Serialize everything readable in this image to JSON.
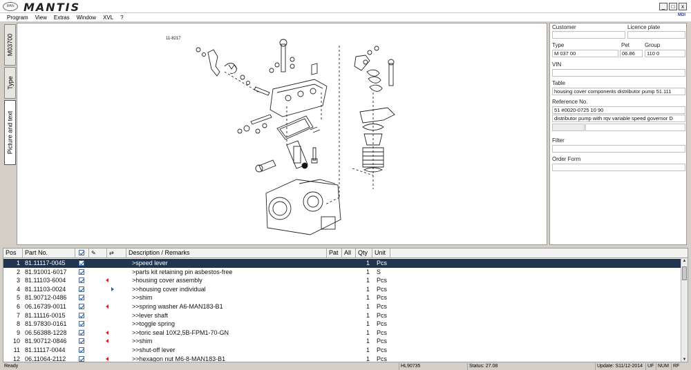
{
  "app": {
    "title": "MANTIS",
    "logo_text": "MAN"
  },
  "window_buttons": {
    "minimize": "_",
    "restore": "□",
    "close": "x"
  },
  "menu": [
    "Program",
    "View",
    "Extras",
    "Window",
    "XVL",
    "?"
  ],
  "mdi_icon_text": "MDI",
  "side_tabs": [
    "M03700",
    "Type",
    "Picture and text"
  ],
  "drawing": {
    "label": "11-8217"
  },
  "info": {
    "customer_label": "Customer",
    "customer_value": "",
    "licence_label": "Licence plate",
    "licence_value": "",
    "type_label": "Type",
    "type_value": "M 037 00",
    "pet_label": "Pet",
    "pet_value": "06.86",
    "group_label": "Group",
    "group_value": "110 0",
    "vin_label": "VIN",
    "vin_value": "",
    "table_label": "Table",
    "table_value": "housing cover components distributor pump  51.111",
    "ref_label": "Reference No.",
    "ref_value": "51 #0020-0725 10 90",
    "ref_desc": "distributor pump with rqv variable speed governor D",
    "filter_label": "Filter",
    "filter_value": "",
    "order_label": "Order Form",
    "order_value": ""
  },
  "table": {
    "headers": {
      "pos": "Pos",
      "part": "Part No.",
      "desc": "Description / Remarks",
      "pat": "Pat",
      "all": "All",
      "qty": "Qty",
      "unit": "Unit"
    },
    "rows": [
      {
        "pos": "1",
        "part": "81.11117-0045",
        "checked": true,
        "mark": "",
        "desc": ">speed lever",
        "qty": "1",
        "unit": "Pcs",
        "selected": true
      },
      {
        "pos": "2",
        "part": "81.91001-6017",
        "checked": true,
        "mark": "",
        "desc": ">parts kit retaining pin asbestos-free",
        "qty": "1",
        "unit": "S",
        "selected": false
      },
      {
        "pos": "3",
        "part": "81.11103-6004",
        "checked": true,
        "mark": "red",
        "desc": ">housing cover assembly",
        "qty": "1",
        "unit": "Pcs",
        "selected": false
      },
      {
        "pos": "4",
        "part": "81.11103-0024",
        "checked": true,
        "mark": "blue",
        "desc": ">>housing cover individual",
        "qty": "1",
        "unit": "Pcs",
        "selected": false
      },
      {
        "pos": "5",
        "part": "81.90712-0486",
        "checked": true,
        "mark": "",
        "desc": ">>shim",
        "qty": "1",
        "unit": "Pcs",
        "selected": false
      },
      {
        "pos": "6",
        "part": "06.16739-0011",
        "checked": true,
        "mark": "red",
        "desc": ">>spring washer A6-MAN183-B1",
        "qty": "1",
        "unit": "Pcs",
        "selected": false
      },
      {
        "pos": "7",
        "part": "81.11116-0015",
        "checked": true,
        "mark": "",
        "desc": ">>lever shaft",
        "qty": "1",
        "unit": "Pcs",
        "selected": false
      },
      {
        "pos": "8",
        "part": "81.97830-0161",
        "checked": true,
        "mark": "",
        "desc": ">>toggle spring",
        "qty": "1",
        "unit": "Pcs",
        "selected": false
      },
      {
        "pos": "9",
        "part": "06.56388-1228",
        "checked": true,
        "mark": "red",
        "desc": ">>toric seal 10X2,5B-FPM1-70-GN",
        "qty": "1",
        "unit": "Pcs",
        "selected": false
      },
      {
        "pos": "10",
        "part": "81.90712-0846",
        "checked": true,
        "mark": "red",
        "desc": ">>shim",
        "qty": "1",
        "unit": "Pcs",
        "selected": false
      },
      {
        "pos": "11",
        "part": "81.11117-0044",
        "checked": true,
        "mark": "",
        "desc": ">>shut-off lever",
        "qty": "1",
        "unit": "Pcs",
        "selected": false
      },
      {
        "pos": "12",
        "part": "06.11064-2112",
        "checked": true,
        "mark": "red",
        "desc": ">>hexagon nut M6-8-MAN183-B1",
        "qty": "1",
        "unit": "Pcs",
        "selected": false
      }
    ]
  },
  "status": {
    "ready": "Ready",
    "code": "HL90735",
    "status": "Status: 27.08",
    "update": "Update: S11/12-2014",
    "uf": "UF",
    "num": "NUM",
    "rf": "RF"
  }
}
